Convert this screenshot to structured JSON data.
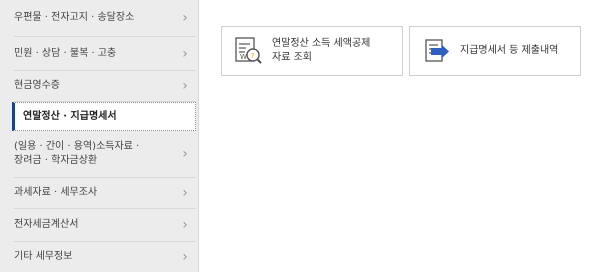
{
  "sidebar": {
    "items": [
      {
        "label": "우편물 · 전자고지 · 송달장소",
        "icon": "chevron-right-icon"
      },
      {
        "label": "민원 · 상담 · 불복 · 고충",
        "icon": "chevron-right-icon"
      },
      {
        "label": "현금영수증",
        "icon": "chevron-right-icon"
      },
      {
        "label": "연말정산 · 지급명세서",
        "active": true
      },
      {
        "label": "(일용 · 간이 · 용역)소득자료 ·\n장려금 · 학자금상환",
        "icon": "chevron-right-icon"
      },
      {
        "label": "과세자료 · 세무조사",
        "icon": "chevron-right-icon"
      },
      {
        "label": "전자세금계산서",
        "icon": "chevron-right-icon"
      },
      {
        "label": "기타 세무정보",
        "icon": "chevron-right-icon"
      }
    ],
    "chevron_glyph": "›"
  },
  "cards": [
    {
      "label": "연말정산 소득 세액공제\n자료 조회",
      "icon": "document-search-icon"
    },
    {
      "label": "지급명세서 등 제출내역",
      "icon": "document-submit-icon"
    }
  ],
  "colors": {
    "sidebar_bg": "#ececec",
    "active_accent": "#1f3f8f",
    "icon_accent": "#f2a100",
    "icon_blue": "#2f5fbf"
  }
}
